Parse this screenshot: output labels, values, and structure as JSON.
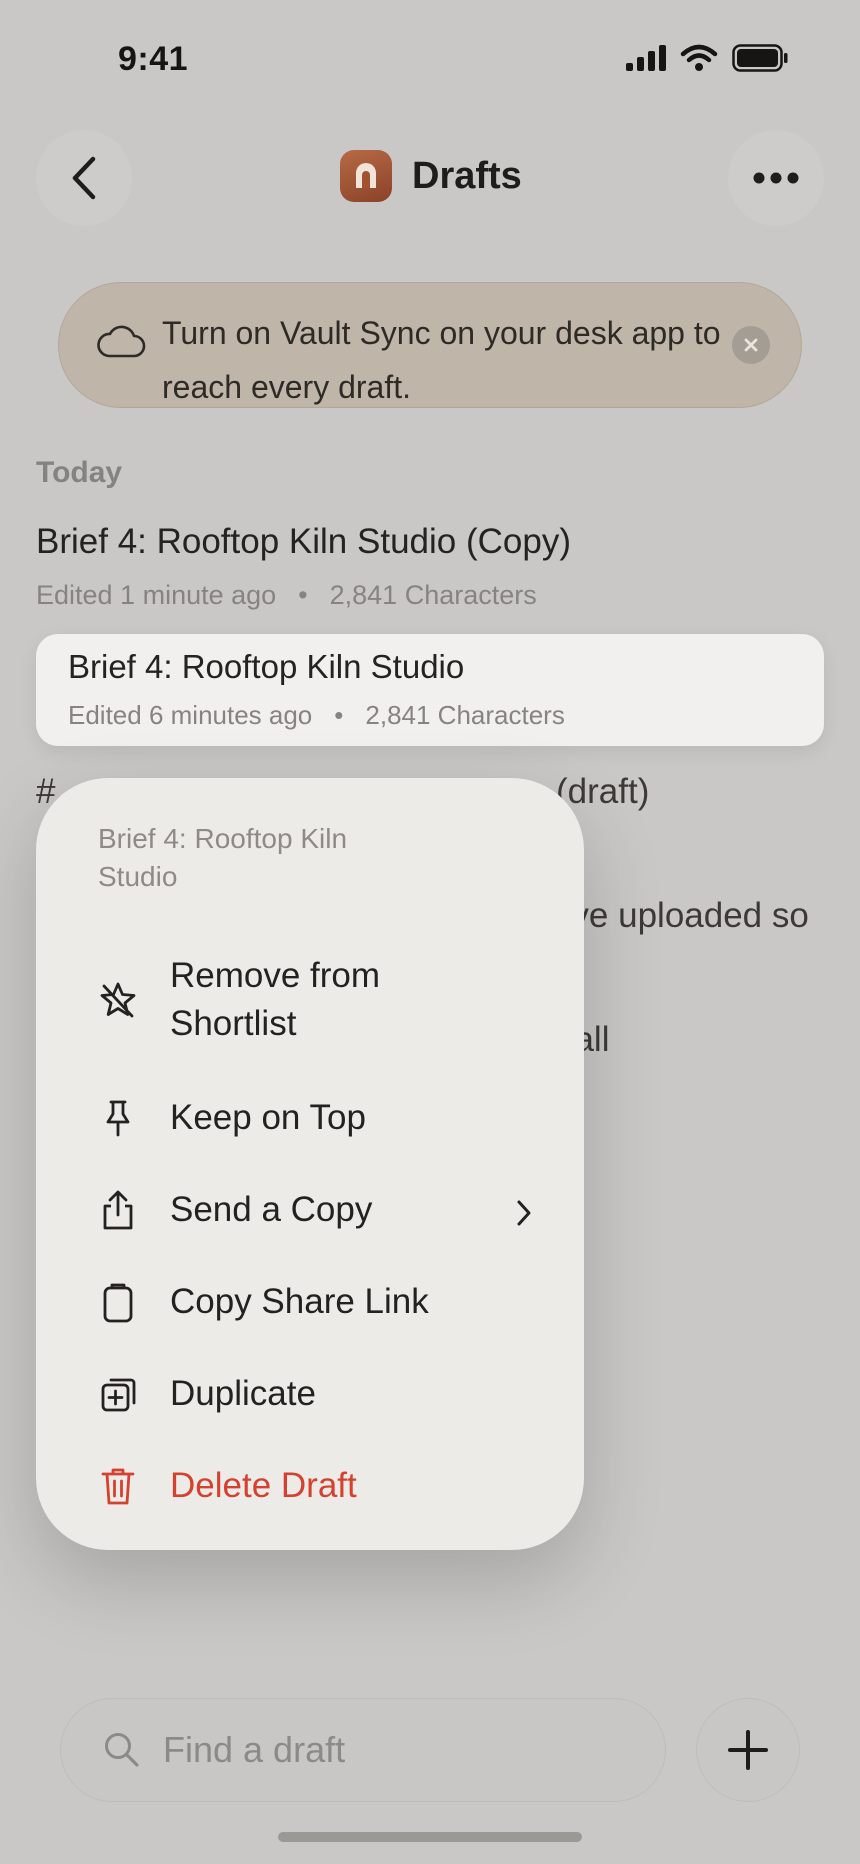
{
  "status_bar": {
    "time": "9:41"
  },
  "header": {
    "title": "Drafts"
  },
  "banner": {
    "text": "Turn on Vault Sync on your desk app to reach every draft."
  },
  "list": {
    "section_label": "Today",
    "items": [
      {
        "title": "Brief 4: Rooftop Kiln Studio (Copy)",
        "edited": "Edited 1 minute ago",
        "separator": "•",
        "chars": "2,841 Characters"
      },
      {
        "title": "Brief 4: Rooftop Kiln Studio",
        "edited": "Edited 6 minutes ago",
        "separator": "•",
        "chars": "2,841 Characters"
      }
    ],
    "obscured": {
      "line1_prefix": "#",
      "line1_suffix": "(draft)",
      "line2_suffix": "we've uploaded so",
      "line3_suffix": "n wall"
    }
  },
  "context_menu": {
    "header": "Brief 4: Rooftop Kiln Studio",
    "items": [
      {
        "label": "Remove from Shortlist",
        "icon": "star-slash-icon"
      },
      {
        "label": "Keep on Top",
        "icon": "pin-icon"
      },
      {
        "label": "Send a Copy",
        "icon": "share-icon",
        "has_submenu": true
      },
      {
        "label": "Copy Share Link",
        "icon": "clipboard-icon"
      },
      {
        "label": "Duplicate",
        "icon": "duplicate-icon"
      },
      {
        "label": "Delete Draft",
        "icon": "trash-icon",
        "destructive": true
      }
    ]
  },
  "search": {
    "placeholder": "Find a draft"
  },
  "colors": {
    "destructive": "#d4422f",
    "app_icon": "#a2522f",
    "banner": "#bfb5a8"
  }
}
